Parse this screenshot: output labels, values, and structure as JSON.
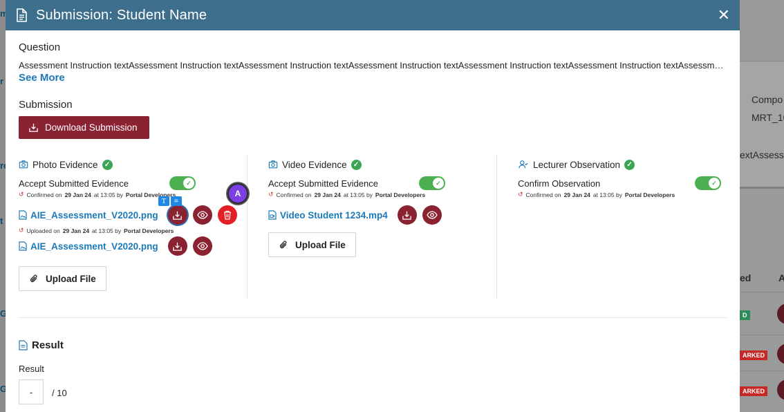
{
  "background": {
    "right_texts": [
      "Compo",
      "MRT_10",
      "extAssessm",
      "ed",
      "A"
    ],
    "right_tags": [
      {
        "text": "D",
        "color": "#2e8b57"
      },
      {
        "text": "ARKED",
        "color": "#c62828"
      },
      {
        "text": "ARKED",
        "color": "#c62828"
      }
    ],
    "left_chips": [
      "m",
      "r",
      "re",
      "t",
      "G",
      "G"
    ]
  },
  "modal": {
    "title": "Submission: Student Name",
    "close_label": "✕"
  },
  "question": {
    "heading": "Question",
    "text": "Assessment Instruction textAssessment Instruction textAssessment Instruction textAssessment Instruction textAssessment Instruction textAssessment Instruction textAssessment Instruction text",
    "see_more": "See More"
  },
  "submission": {
    "heading": "Submission",
    "download_label": "Download Submission"
  },
  "photo_evidence": {
    "title": "Photo Evidence",
    "accept_label": "Accept Submitted Evidence",
    "accepted": true,
    "confirm_meta": {
      "prefix": "Confirmed on",
      "date": "29 Jan 24",
      "at": "at 13:05 by",
      "user": "Portal Developers"
    },
    "files": [
      {
        "name": "AIE_Assessment_V2020.png",
        "can_delete": true
      },
      {
        "name": "AIE_Assessment_V2020.png",
        "can_delete": false
      }
    ],
    "upload_meta": {
      "prefix": "Uploaded on",
      "date": "29 Jan 24",
      "at": "at 13:05 by",
      "user": "Portal Developers"
    },
    "upload_label": "Upload File"
  },
  "video_evidence": {
    "title": "Video Evidence",
    "accept_label": "Accept Submitted Evidence",
    "accepted": true,
    "confirm_meta": {
      "prefix": "Confirmed on",
      "date": "29 Jan 24",
      "at": "at 13:05 by",
      "user": "Portal Developers"
    },
    "files": [
      {
        "name": "Video Student 1234.mp4"
      }
    ],
    "upload_label": "Upload File"
  },
  "lecturer_observation": {
    "title": "Lecturer Observation",
    "confirm_label": "Confirm Observation",
    "confirmed": true,
    "confirm_meta": {
      "prefix": "Confirmed on",
      "date": "29 Jan 24",
      "at": "at 13:05 by",
      "user": "Portal Developers"
    }
  },
  "result": {
    "heading": "Result",
    "label": "Result",
    "value": "-",
    "max": "/ 10"
  },
  "overlays": {
    "avatar_letter": "A",
    "toolbar": [
      "T",
      "≡"
    ]
  },
  "colors": {
    "header": "#3d6e8c",
    "primary": "#8b2231",
    "danger": "#e31e24",
    "success": "#4caf50",
    "link": "#1b79b8"
  }
}
